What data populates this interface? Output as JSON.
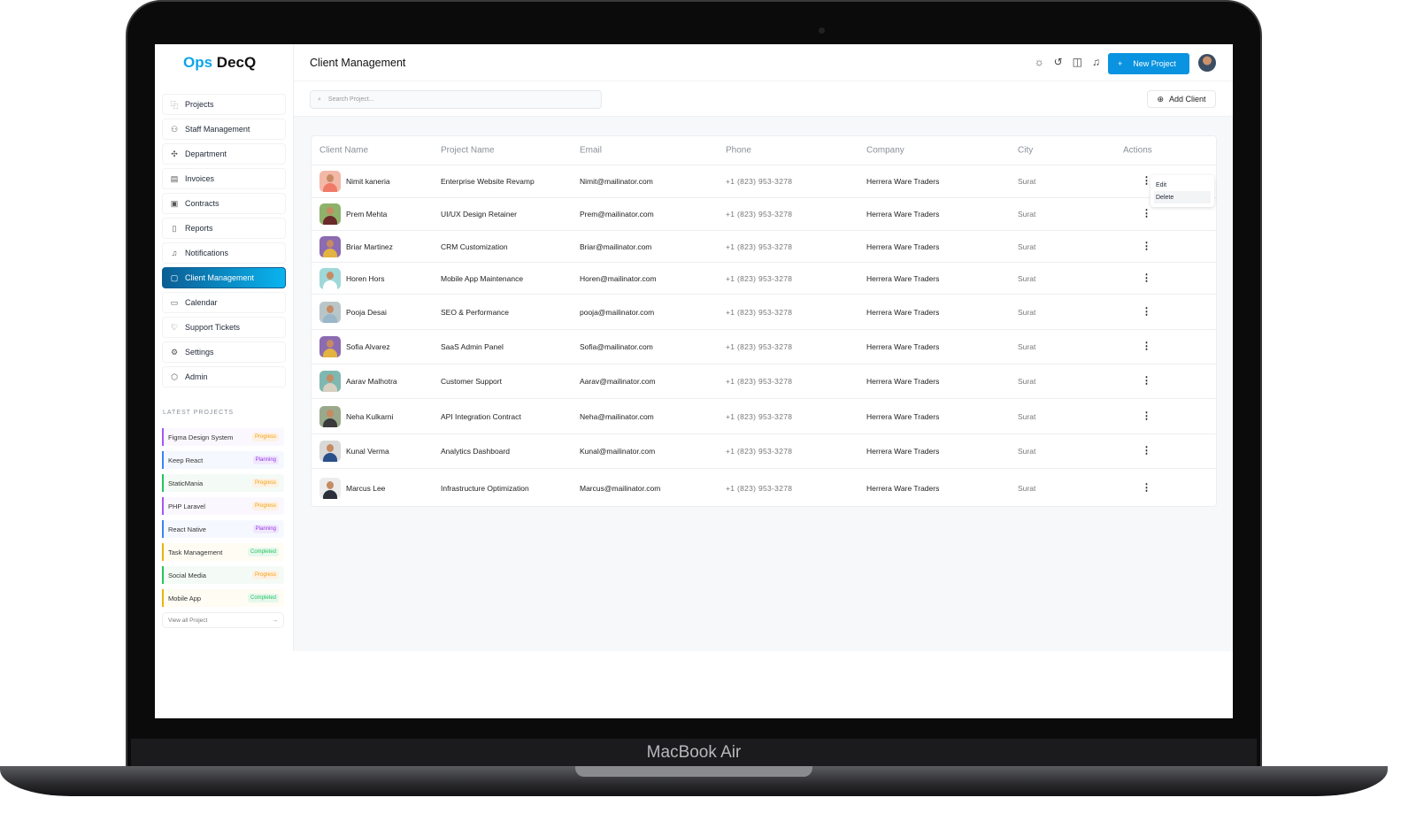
{
  "device_label": "MacBook Air",
  "brand": {
    "logo_accent": "Ops",
    "logo_rest": " DecQ"
  },
  "header": {
    "title": "Client Management",
    "new_project": "New Project",
    "icons": [
      "sun-icon",
      "history-icon",
      "sidebar-icon",
      "bell-icon"
    ]
  },
  "sidebar": {
    "items": [
      {
        "label": "Projects",
        "icon": "⿻"
      },
      {
        "label": "Staff Management",
        "icon": "⚇"
      },
      {
        "label": "Department",
        "icon": "✣"
      },
      {
        "label": "Invoices",
        "icon": "▤"
      },
      {
        "label": "Contracts",
        "icon": "▣"
      },
      {
        "label": "Reports",
        "icon": "▯"
      },
      {
        "label": "Notifications",
        "icon": "♫"
      },
      {
        "label": "Client Management",
        "icon": "▢",
        "active": true
      },
      {
        "label": "Calendar",
        "icon": "▭"
      },
      {
        "label": "Support Tickets",
        "icon": "♡"
      },
      {
        "label": "Settings",
        "icon": "⚙"
      },
      {
        "label": "Admin",
        "icon": "⬡"
      }
    ],
    "latest_title": "LATEST PROJECTS",
    "latest": [
      {
        "name": "Figma Design System",
        "status": "Progress",
        "color": "#a855f7",
        "bg": "#faf7fe"
      },
      {
        "name": "Keep React",
        "status": "Planning",
        "color": "#3b82f6",
        "bg": "#f5f9ff"
      },
      {
        "name": "StaticMania",
        "status": "Progress",
        "color": "#22c55e",
        "bg": "#f4fbf6"
      },
      {
        "name": "PHP Laravel",
        "status": "Progress",
        "color": "#a855f7",
        "bg": "#faf7fe"
      },
      {
        "name": "React Native",
        "status": "Planning",
        "color": "#3b82f6",
        "bg": "#f5f9ff"
      },
      {
        "name": "Task Management",
        "status": "Completed",
        "color": "#eab308",
        "bg": "#fefcf3"
      },
      {
        "name": "Social Media",
        "status": "Progress",
        "color": "#22c55e",
        "bg": "#f4fbf6"
      },
      {
        "name": "Mobile App",
        "status": "Completed",
        "color": "#eab308",
        "bg": "#fefcf3"
      }
    ],
    "view_all": "View all Project"
  },
  "search": {
    "placeholder": "Search Project..."
  },
  "add_client": "Add Client",
  "table": {
    "headers": [
      "Client Name",
      "Project Name",
      "Email",
      "Phone",
      "Company",
      "City",
      "Actions"
    ],
    "rows": [
      {
        "name": "Nimit kaneria",
        "project": "Enterprise Website Revamp",
        "email": "Nimit@mailinator.com",
        "phone": "+1 (823) 953-3278",
        "company": "Herrera Ware Traders",
        "city": "Surat",
        "bg": "#f3b8a8",
        "shirt": "#f07a68"
      },
      {
        "name": "Prem Mehta",
        "project": "UI/UX Design Retainer",
        "email": "Prem@mailinator.com",
        "phone": "+1 (823) 953-3278",
        "company": "Herrera Ware Traders",
        "city": "Surat",
        "bg": "#8fb26b",
        "shirt": "#6b2a2a"
      },
      {
        "name": "Briar Martinez",
        "project": "CRM Customization",
        "email": "Briar@mailinator.com",
        "phone": "+1 (823) 953-3278",
        "company": "Herrera Ware Traders",
        "city": "Surat",
        "bg": "#8c6bb0",
        "shirt": "#e2b341"
      },
      {
        "name": "Horen Hors",
        "project": "Mobile App Maintenance",
        "email": "Horen@mailinator.com",
        "phone": "+1 (823) 953-3278",
        "company": "Herrera Ware Traders",
        "city": "Surat",
        "bg": "#9fd8d8",
        "shirt": "#ffffff"
      },
      {
        "name": "Pooja Desai",
        "project": "SEO & Performance",
        "email": "pooja@mailinator.com",
        "phone": "+1 (823) 953-3278",
        "company": "Herrera Ware Traders",
        "city": "Surat",
        "bg": "#b9c6c9",
        "shirt": "#9ab6c9"
      },
      {
        "name": "Sofia Alvarez",
        "project": "SaaS Admin Panel",
        "email": "Sofia@mailinator.com",
        "phone": "+1 (823) 953-3278",
        "company": "Herrera Ware Traders",
        "city": "Surat",
        "bg": "#8c6bb0",
        "shirt": "#e2b341"
      },
      {
        "name": "Aarav Malhotra",
        "project": "Customer Support",
        "email": "Aarav@mailinator.com",
        "phone": "+1 (823) 953-3278",
        "company": "Herrera Ware Traders",
        "city": "Surat",
        "bg": "#7fb8b0",
        "shirt": "#d8d0c0"
      },
      {
        "name": "Neha Kulkarni",
        "project": "API Integration Contract",
        "email": "Neha@mailinator.com",
        "phone": "+1 (823) 953-3278",
        "company": "Herrera Ware Traders",
        "city": "Surat",
        "bg": "#9aa98c",
        "shirt": "#3a3a3a"
      },
      {
        "name": "Kunal Verma",
        "project": "Analytics Dashboard",
        "email": "Kunal@mailinator.com",
        "phone": "+1 (823) 953-3278",
        "company": "Herrera Ware Traders",
        "city": "Surat",
        "bg": "#d9d9d9",
        "shirt": "#2a4f8a"
      },
      {
        "name": "Marcus Lee",
        "project": "Infrastructure Optimization",
        "email": "Marcus@mailinator.com",
        "phone": "+1 (823) 953-3278",
        "company": "Herrera Ware Traders",
        "city": "Surat",
        "bg": "#ececec",
        "shirt": "#2a2f3a"
      }
    ]
  },
  "row_menu": {
    "edit": "Edit",
    "delete": "Delete"
  }
}
